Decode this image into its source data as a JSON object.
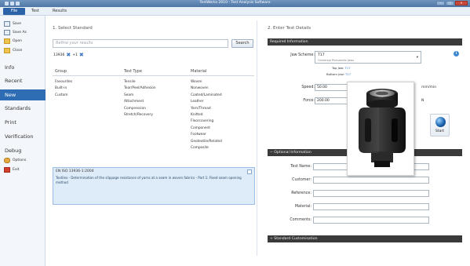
{
  "window": {
    "title": "TestWorks 2010 - Test Analysis Software"
  },
  "menu": {
    "file": "File",
    "test": "Test",
    "results": "Results"
  },
  "nav": {
    "save": "Save",
    "save_as": "Save As",
    "open": "Open",
    "close": "Close",
    "info": "Info",
    "recent": "Recent",
    "new": "New",
    "standards": "Standards",
    "print": "Print",
    "verification": "Verification",
    "debug": "Debug",
    "options": "Options",
    "exit": "Exit"
  },
  "left": {
    "heading": "1. Select Standard",
    "search_placeholder": "Refine your results",
    "search_button": "Search",
    "filter_value": "13936",
    "filter_suffix": "+1",
    "columns": {
      "group": "Group",
      "test_type": "Test Type",
      "material": "Material"
    },
    "groups": [
      "Favourites",
      "Built-in",
      "Custom"
    ],
    "test_types": [
      "Tensile",
      "Tear/Peel/Adhesion",
      "Seam",
      "Attachment",
      "Compression",
      "Stretch/Recovery"
    ],
    "materials": [
      "Woven",
      "Nonwoven",
      "Coated/Laminated",
      "Leather",
      "Yarn/Thread",
      "Knitted",
      "Floorcovering",
      "Component",
      "Footwear",
      "Geotextile/Related",
      "Composite"
    ],
    "selected_standard": {
      "code": "EN ISO 13936-1:2004",
      "description": "Textiles - Determination of the slippage resistance of yarns at a seam in woven fabrics - Part 1: Fixed seam opening method"
    }
  },
  "right": {
    "heading": "2. Enter Test Details",
    "required_bar": "Required Information",
    "jaw_scheme_label": "Jaw Scheme:",
    "jaw_scheme_value": "T17",
    "jaw_scheme_sub": "Universal Pneumatic Jaws",
    "top_jaw_label": "Top Jaw:",
    "top_jaw_value": "T17",
    "bottom_jaw_label": "Bottom Jaw:",
    "bottom_jaw_value": "T17",
    "speed_label": "Speed:",
    "speed_value": "50.00",
    "speed_unit": "mm/min",
    "force_label": "Force:",
    "force_value": "200.00",
    "force_unit": "N",
    "start_button": "Start",
    "optional_bar": "− Optional Information",
    "optional_fields": [
      "Test Name:",
      "Customer:",
      "Reference:",
      "Material:",
      "Comments:"
    ],
    "customisation_bar": "+ Standard Customisation"
  },
  "icons": {
    "info": "info-icon",
    "start": "start-icon",
    "remove_filter": "remove-filter-icon"
  },
  "colors": {
    "accent": "#2e6db4",
    "bar": "#3a3a3a",
    "selection": "#deebf8"
  }
}
